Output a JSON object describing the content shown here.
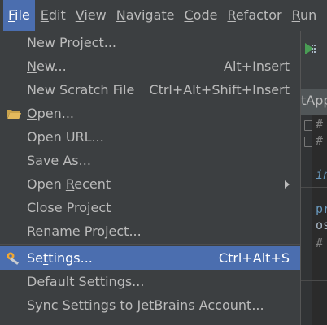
{
  "menubar": {
    "items": [
      {
        "label": "File",
        "mnemonic": "F",
        "rest": "ile"
      },
      {
        "label": "Edit",
        "mnemonic": "E",
        "rest": "dit"
      },
      {
        "label": "View",
        "mnemonic": "V",
        "rest": "iew"
      },
      {
        "label": "Navigate",
        "mnemonic": "N",
        "rest": "avigate"
      },
      {
        "label": "Code",
        "mnemonic": "C",
        "rest": "ode"
      },
      {
        "label": "Refactor",
        "mnemonic": "R",
        "rest": "efactor"
      },
      {
        "label": "Run",
        "mnemonic": "R",
        "rest": "un"
      }
    ]
  },
  "background": {
    "tab_text": "tApp",
    "code_lines": [
      "#",
      "#",
      "in",
      "pr",
      "os",
      "#"
    ]
  },
  "file_menu": {
    "items": [
      {
        "pre": "New Project...",
        "u": "",
        "post": "",
        "shortcut": ""
      },
      {
        "pre": "",
        "u": "N",
        "post": "ew...",
        "shortcut": "Alt+Insert"
      },
      {
        "pre": "New Scratch File",
        "u": "",
        "post": "",
        "shortcut": "Ctrl+Alt+Shift+Insert"
      },
      {
        "pre": "",
        "u": "O",
        "post": "pen...",
        "shortcut": ""
      },
      {
        "pre": "Open URL...",
        "u": "",
        "post": "",
        "shortcut": ""
      },
      {
        "pre": "Save As...",
        "u": "",
        "post": "",
        "shortcut": ""
      },
      {
        "pre": "Open ",
        "u": "R",
        "post": "ecent",
        "shortcut": ""
      },
      {
        "pre": "Close Project",
        "u": "",
        "post": "",
        "shortcut": ""
      },
      {
        "pre": "Rename Project...",
        "u": "",
        "post": "",
        "shortcut": ""
      },
      {
        "pre": "Se",
        "u": "t",
        "post": "tings...",
        "shortcut": "Ctrl+Alt+S"
      },
      {
        "pre": "Def",
        "u": "a",
        "post": "ult Settings...",
        "shortcut": ""
      },
      {
        "pre": "Sync Settings to JetBrains Account...",
        "u": "",
        "post": "",
        "shortcut": ""
      }
    ]
  },
  "colors": {
    "menu_bg": "#3c3f41",
    "selection": "#4b6eaf",
    "text": "#bbbbbb",
    "selected_text": "#ffffff"
  }
}
